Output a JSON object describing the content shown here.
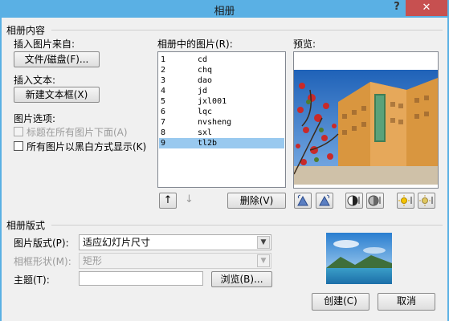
{
  "window": {
    "title": "相册",
    "help_label": "?",
    "close_label": "✕"
  },
  "album_content": {
    "group_label": "相册内容",
    "insert_picture_label": "插入图片来自:",
    "file_disk_button": "文件/磁盘(F)...",
    "insert_text_label": "插入文本:",
    "new_textbox_button": "新建文本框(X)",
    "picture_options_label": "图片选项:",
    "captions_below_label": "标题在所有图片下面(A)",
    "black_white_label": "所有图片以黑白方式显示(K)"
  },
  "pictures_in_album": {
    "label": "相册中的图片(R):",
    "items": [
      {
        "num": "1",
        "name": "cd"
      },
      {
        "num": "2",
        "name": "chq"
      },
      {
        "num": "3",
        "name": "dao"
      },
      {
        "num": "4",
        "name": "jd"
      },
      {
        "num": "5",
        "name": "jxl001"
      },
      {
        "num": "6",
        "name": "lqc"
      },
      {
        "num": "7",
        "name": "nvsheng"
      },
      {
        "num": "8",
        "name": "sxl"
      },
      {
        "num": "9",
        "name": "tl2b"
      }
    ],
    "selected_index": 8,
    "move_up_symbol": "↑",
    "move_down_symbol": "↓",
    "delete_button": "删除(V)"
  },
  "preview": {
    "label": "预览:"
  },
  "album_layout": {
    "group_label": "相册版式",
    "picture_layout_label": "图片版式(P):",
    "picture_layout_value": "适应幻灯片尺寸",
    "frame_shape_label": "相框形状(M):",
    "frame_shape_value": "矩形",
    "theme_label": "主题(T):",
    "theme_value": "",
    "browse_button": "浏览(B)..."
  },
  "footer": {
    "create_button": "创建(C)",
    "cancel_button": "取消"
  },
  "colors": {
    "titlebar": "#5ab0e4",
    "close": "#c75050",
    "selection": "#99c9ef"
  }
}
